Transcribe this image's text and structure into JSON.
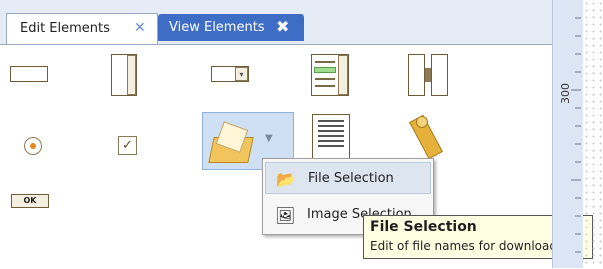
{
  "tabs": [
    {
      "label": "Edit Elements",
      "close_glyph": "✕",
      "active": true
    },
    {
      "label": "View Elements",
      "close_glyph": "✖",
      "active": false
    }
  ],
  "ruler": {
    "mark": "300"
  },
  "palette": {
    "items": [
      {
        "icon": "textbox-icon"
      },
      {
        "icon": "textarea-spinner-icon"
      },
      {
        "icon": "dropdown-icon"
      },
      {
        "icon": "list-icon"
      },
      {
        "icon": "two-column-list-icon"
      },
      {
        "icon": "radio-button-icon"
      },
      {
        "icon": "checkbox-icon"
      },
      {
        "icon": "file-selection-icon"
      },
      {
        "icon": "document-icon"
      },
      {
        "icon": "bookmark-icon"
      },
      {
        "icon": "ok-button-icon",
        "label": "OK"
      }
    ]
  },
  "context_menu": {
    "items": [
      {
        "label": "File Selection",
        "icon": "folder-icon",
        "highlighted": true
      },
      {
        "label": "Image Selection",
        "icon": "image-icon",
        "highlighted": false
      }
    ]
  },
  "tooltip": {
    "title": "File Selection",
    "description": "Edit of file names for downloads"
  },
  "colors": {
    "accent": "#3d6dc4",
    "tooltip_bg": "#ffffe1",
    "selection_bg": "#cfe0f5",
    "ruler_bg": "#dce6f4"
  }
}
